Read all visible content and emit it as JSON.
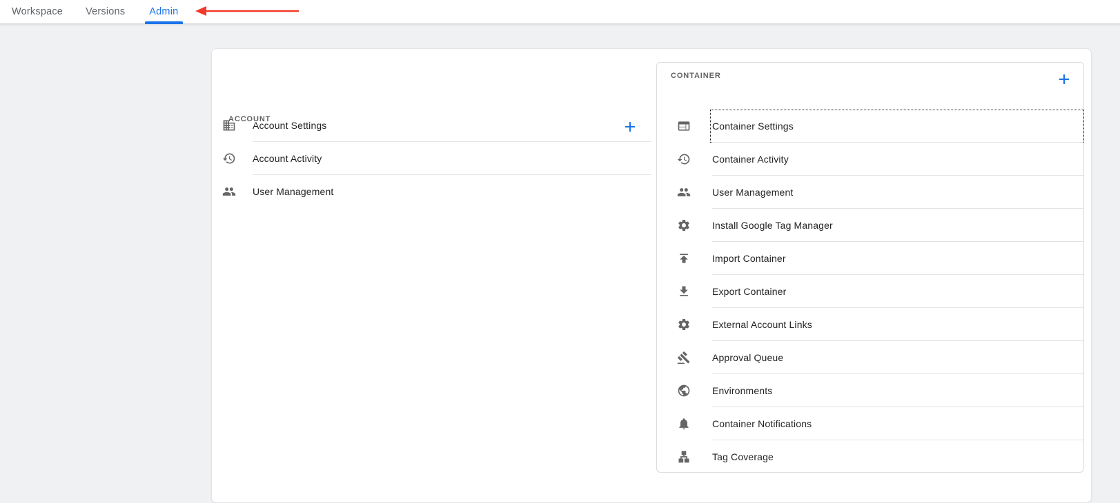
{
  "nav": {
    "tabs": [
      {
        "label": "Workspace",
        "active": false
      },
      {
        "label": "Versions",
        "active": false
      },
      {
        "label": "Admin",
        "active": true
      }
    ]
  },
  "annotation": {
    "type": "arrow-pointing-left",
    "target": "Admin tab",
    "color": "#f13a2a"
  },
  "account": {
    "title": "ACCOUNT",
    "add_button": "add",
    "items": [
      {
        "label": "Account Settings",
        "icon": "domain-icon"
      },
      {
        "label": "Account Activity",
        "icon": "history-icon"
      },
      {
        "label": "User Management",
        "icon": "people-icon"
      }
    ]
  },
  "container": {
    "title": "CONTAINER",
    "add_button": "add",
    "items": [
      {
        "label": "Container Settings",
        "icon": "web-icon",
        "focused": true
      },
      {
        "label": "Container Activity",
        "icon": "history-icon"
      },
      {
        "label": "User Management",
        "icon": "people-icon"
      },
      {
        "label": "Install Google Tag Manager",
        "icon": "settings-icon"
      },
      {
        "label": "Import Container",
        "icon": "upload-icon"
      },
      {
        "label": "Export Container",
        "icon": "download-icon"
      },
      {
        "label": "External Account Links",
        "icon": "settings-icon"
      },
      {
        "label": "Approval Queue",
        "icon": "gavel-icon"
      },
      {
        "label": "Environments",
        "icon": "globe-icon"
      },
      {
        "label": "Container Notifications",
        "icon": "bell-icon"
      },
      {
        "label": "Tag Coverage",
        "icon": "lan-icon"
      }
    ]
  },
  "colors": {
    "accent_blue": "#1a73e8",
    "arrow_red": "#f13a2a",
    "page_background": "#eff1f3",
    "card_background": "#ffffff",
    "divider": "#e3e3e3",
    "section_title": "#616161",
    "item_text": "#232323",
    "nav_text": "#5f6368"
  }
}
